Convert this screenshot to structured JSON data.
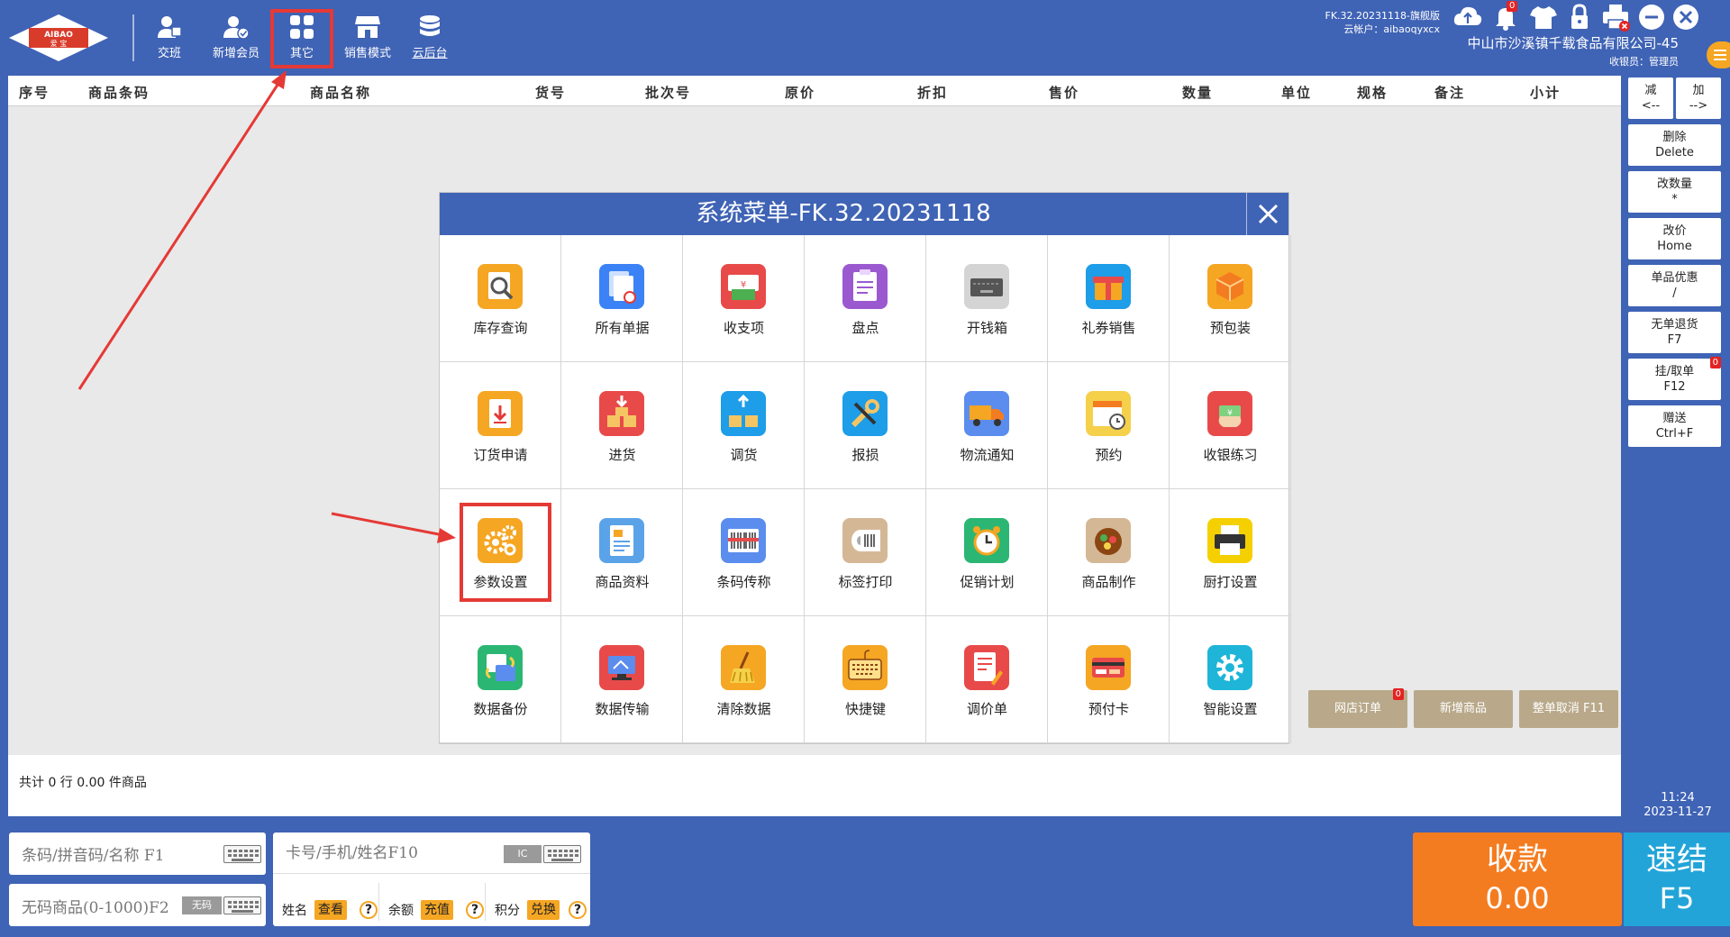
{
  "toolbar": {
    "logo_text_1": "AIBAO",
    "logo_text_2": "爱 宝",
    "buttons": [
      {
        "label": "交班",
        "icon": "handover-icon"
      },
      {
        "label": "新增会员",
        "icon": "add-member-icon"
      },
      {
        "label": "其它",
        "icon": "grid-apps-icon",
        "selected": true
      },
      {
        "label": "销售模式",
        "icon": "store-icon"
      },
      {
        "label": "云后台",
        "icon": "cloud-database-icon"
      }
    ]
  },
  "header_info": {
    "version": "FK.32.20231118-旗舰版",
    "cloud_account": "云帐户：aibaoqyxcx",
    "notification_count": "0",
    "company": "中山市沙溪镇千载食品有限公司-45",
    "cashier": "收银员：管理员"
  },
  "table": {
    "columns": [
      "序号",
      "商品条码",
      "商品名称",
      "货号",
      "批次号",
      "原价",
      "折扣",
      "售价",
      "数量",
      "单位",
      "规格",
      "备注",
      "小计"
    ]
  },
  "summary": {
    "text": "共计 0 行 0.00 件商品"
  },
  "actions": {
    "online_order": "网店订单",
    "online_order_count": "0",
    "new_product": "新增商品",
    "cancel_all": "整单取消 F11"
  },
  "function_keys": [
    {
      "line1": "减",
      "line2": "<--"
    },
    {
      "line1": "加",
      "line2": "-->"
    },
    {
      "line1": "删除",
      "line2": "Delete"
    },
    {
      "line1": "改数量",
      "line2": "*"
    },
    {
      "line1": "改价",
      "line2": "Home"
    },
    {
      "line1": "单品优惠",
      "line2": "/"
    },
    {
      "line1": "无单退货",
      "line2": "F7"
    },
    {
      "line1": "挂/取单",
      "line2": "F12",
      "badge": "0"
    },
    {
      "line1": "赠送",
      "line2": "Ctrl+F"
    }
  ],
  "clock": {
    "time": "11:24",
    "date": "2023-11-27"
  },
  "inputs": {
    "barcode_placeholder": "条码/拼音码/名称  F1",
    "nocode_placeholder": "无码商品(0-1000)F2",
    "nocode_tag": "无码",
    "member_placeholder": "卡号/手机/姓名F10",
    "ic_tag": "IC"
  },
  "member": {
    "name_label": "姓名",
    "view_btn": "查看",
    "balance_label": "余额",
    "recharge_btn": "充值",
    "points_label": "积分",
    "redeem_btn": "兑换",
    "help": "?"
  },
  "payment": {
    "collect_label": "收款",
    "amount": "0.00",
    "quick_label": "速结",
    "quick_key": "F5"
  },
  "modal": {
    "title": "系统菜单-FK.32.20231118",
    "items": [
      {
        "label": "库存查询",
        "icon": "inventory-search-icon"
      },
      {
        "label": "所有单据",
        "icon": "documents-icon"
      },
      {
        "label": "收支项",
        "icon": "income-expense-icon"
      },
      {
        "label": "盘点",
        "icon": "stocktake-icon"
      },
      {
        "label": "开钱箱",
        "icon": "cash-drawer-icon"
      },
      {
        "label": "礼券销售",
        "icon": "gift-voucher-icon"
      },
      {
        "label": "预包装",
        "icon": "prepackage-icon"
      },
      {
        "label": "订货申请",
        "icon": "order-request-icon"
      },
      {
        "label": "进货",
        "icon": "purchase-icon"
      },
      {
        "label": "调货",
        "icon": "transfer-icon"
      },
      {
        "label": "报损",
        "icon": "damage-report-icon"
      },
      {
        "label": "物流通知",
        "icon": "logistics-truck-icon"
      },
      {
        "label": "预约",
        "icon": "appointment-icon"
      },
      {
        "label": "收银练习",
        "icon": "cashier-practice-icon"
      },
      {
        "label": "参数设置",
        "icon": "settings-gears-icon",
        "highlight": true
      },
      {
        "label": "商品资料",
        "icon": "product-info-icon"
      },
      {
        "label": "条码传称",
        "icon": "barcode-scale-icon"
      },
      {
        "label": "标签打印",
        "icon": "label-print-icon"
      },
      {
        "label": "促销计划",
        "icon": "promotion-plan-icon"
      },
      {
        "label": "商品制作",
        "icon": "product-making-icon"
      },
      {
        "label": "厨打设置",
        "icon": "kitchen-print-icon"
      },
      {
        "label": "数据备份",
        "icon": "data-backup-icon"
      },
      {
        "label": "数据传输",
        "icon": "data-transfer-icon"
      },
      {
        "label": "清除数据",
        "icon": "clear-data-icon"
      },
      {
        "label": "快捷键",
        "icon": "shortcut-keyboard-icon"
      },
      {
        "label": "调价单",
        "icon": "price-adjust-icon"
      },
      {
        "label": "预付卡",
        "icon": "prepaid-card-icon"
      },
      {
        "label": "智能设置",
        "icon": "smart-settings-icon"
      }
    ]
  },
  "colors": {
    "brand_blue": "#3f63b5",
    "accent_orange": "#f47c20",
    "quick_blue": "#22a4d8",
    "highlight_red": "#e53935",
    "action_tan": "#b9a98a"
  }
}
